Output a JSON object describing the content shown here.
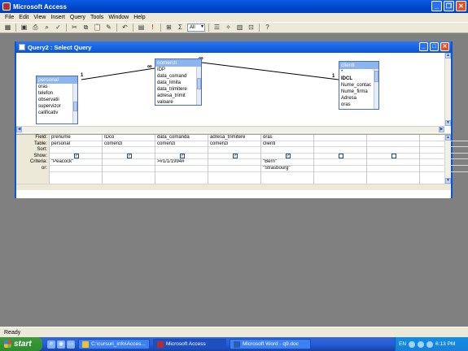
{
  "app": {
    "title": "Microsoft Access"
  },
  "menu": [
    "File",
    "Edit",
    "View",
    "Insert",
    "Query",
    "Tools",
    "Window",
    "Help"
  ],
  "toolbar": {
    "top_values": "All",
    "sigma": "Σ"
  },
  "query_window": {
    "title": "Query2 : Select Query"
  },
  "tables": {
    "personal": {
      "title": "personal",
      "fields": [
        "oras",
        "telefon",
        "observatii",
        "supervizor",
        "calificativ"
      ]
    },
    "comenzi": {
      "title": "comenzi",
      "fields": [
        "IDP",
        "data_comand",
        "data_limita",
        "data_trimitere",
        "adresa_trimit",
        "valoare"
      ]
    },
    "clienti": {
      "title": "clienti",
      "fields": [
        "*",
        "IDCL",
        "Nume_contac",
        "Nume_firma",
        "Adresa",
        "oras"
      ]
    }
  },
  "relations": {
    "one": "1",
    "many": "∞"
  },
  "grid": {
    "row_labels": [
      "Field:",
      "Table:",
      "Sort:",
      "Show:",
      "Criteria:",
      "or:"
    ],
    "columns": [
      {
        "field": "prenume",
        "table": "personal",
        "sort": "",
        "show": true,
        "criteria": "\"Peacock\"",
        "or": ""
      },
      {
        "field": "IDco",
        "table": "comenzi",
        "sort": "",
        "show": true,
        "criteria": "",
        "or": ""
      },
      {
        "field": "data_comanda",
        "table": "comenzi",
        "sort": "",
        "show": true,
        "criteria": ">#1/1/1994#",
        "or": ""
      },
      {
        "field": "adresa_trimitere",
        "table": "comenzi",
        "sort": "",
        "show": true,
        "criteria": "",
        "or": ""
      },
      {
        "field": "oras",
        "table": "clienti",
        "sort": "",
        "show": true,
        "criteria": "\"Bern\"",
        "or": "\"Strasbourg\""
      },
      {
        "field": "",
        "table": "",
        "sort": "",
        "show": false,
        "criteria": "",
        "or": ""
      },
      {
        "field": "",
        "table": "",
        "sort": "",
        "show": false,
        "criteria": "",
        "or": ""
      },
      {
        "field": "",
        "table": "",
        "sort": "",
        "show": false,
        "criteria": "",
        "or": ""
      }
    ]
  },
  "status": {
    "text": "Ready"
  },
  "taskbar": {
    "start": "start",
    "tasks": [
      {
        "label": "C:\\cursuri_info\\Acces...",
        "color": "#f0c030"
      },
      {
        "label": "Microsoft Access",
        "color": "#b03030"
      },
      {
        "label": "Microsoft Word - q9.doc",
        "color": "#2a5db0"
      }
    ],
    "language": "EN",
    "clock": "6:13 PM"
  }
}
